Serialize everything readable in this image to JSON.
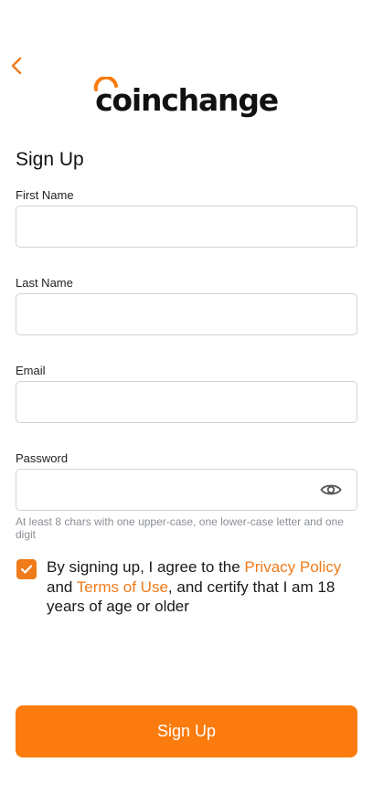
{
  "app": {
    "logo_text": "coinchange"
  },
  "colors": {
    "accent": "#fb7b0e",
    "link": "#f07b1a",
    "border": "#cfd3d8",
    "hint": "#8a8f96"
  },
  "icons": {
    "back": "chevron-left-icon",
    "password_toggle": "eye-icon",
    "checkbox": "checkmark-icon"
  },
  "form": {
    "title": "Sign Up",
    "first_name": {
      "label": "First Name",
      "value": ""
    },
    "last_name": {
      "label": "Last Name",
      "value": ""
    },
    "email": {
      "label": "Email",
      "value": ""
    },
    "password": {
      "label": "Password",
      "value": "",
      "hint": "At least 8 chars with one upper-case, one lower-case letter and one digit"
    }
  },
  "agreement": {
    "checked": true,
    "text_before": "By signing up, I agree to the ",
    "privacy_link": "Privacy Policy",
    "text_and": " and ",
    "terms_link": "Terms of Use",
    "text_after": ", and certify that I am 18 years of age or older"
  },
  "submit": {
    "label": "Sign Up"
  }
}
